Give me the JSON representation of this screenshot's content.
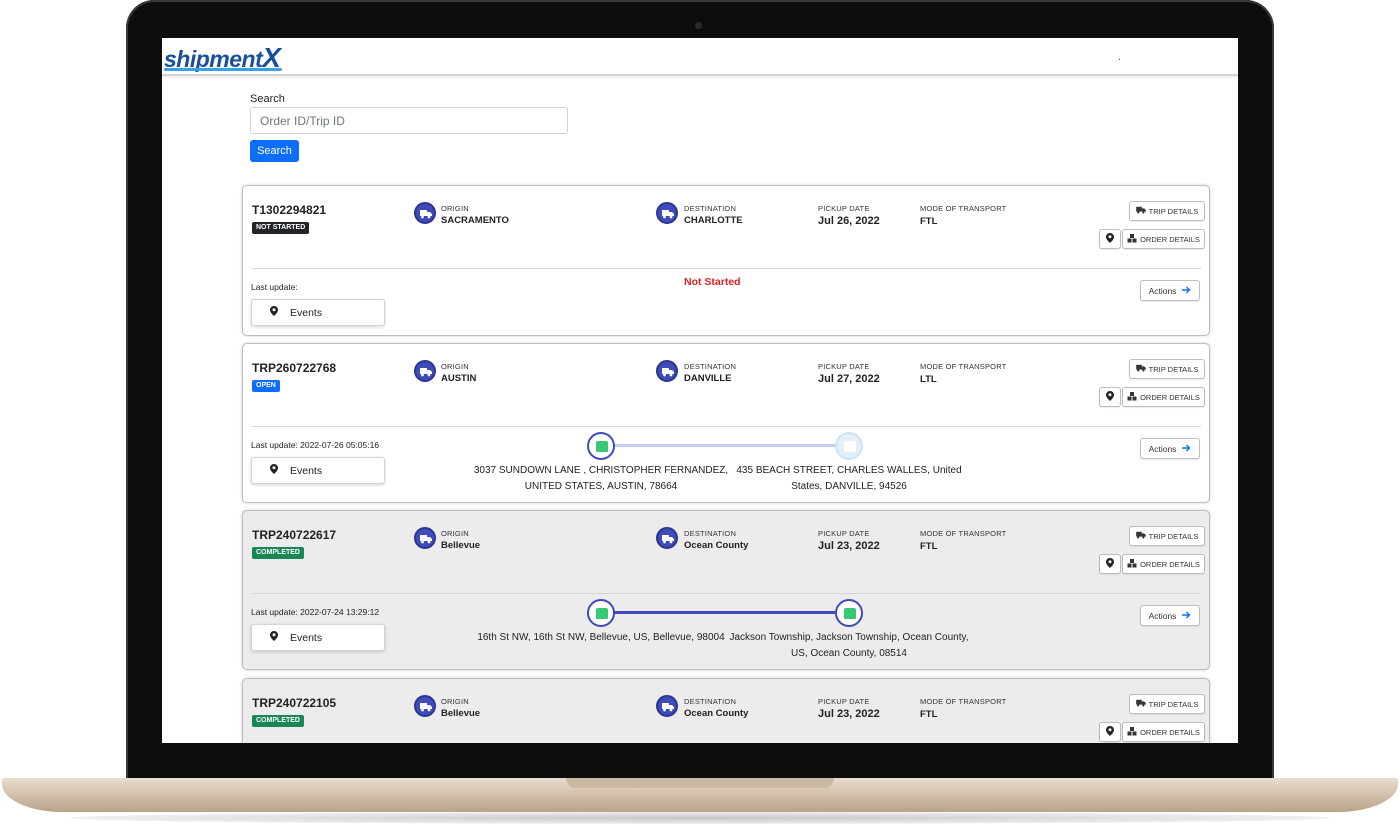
{
  "app": {
    "logo_text": "shipment",
    "logo_x": "X",
    "header_dot": "."
  },
  "search": {
    "label": "Search",
    "placeholder": "Order ID/Trip ID",
    "button": "Search"
  },
  "labels": {
    "origin": "ORIGIN",
    "destination": "DESTINATION",
    "pickup_date": "PICKUP DATE",
    "mode": "MODE OF TRANSPORT",
    "trip_details": "TRIP DETAILS",
    "order_details": "ORDER DETAILS",
    "actions": "Actions",
    "events": "Events"
  },
  "trips": [
    {
      "id": "T1302294821",
      "status": "NOT STARTED",
      "status_color": "#212529",
      "origin": "SACRAMENTO",
      "destination": "CHARLOTTE",
      "pickup_date": "Jul 26, 2022",
      "mode": "FTL",
      "last_update": "Last update:",
      "status_message": "Not Started"
    },
    {
      "id": "TRP260722768",
      "status": "OPEN",
      "status_color": "#0d6efd",
      "origin": "AUSTIN",
      "destination": "DANVILLE",
      "pickup_date": "Jul 27, 2022",
      "mode": "LTL",
      "last_update": "Last update: 2022-07-26 05:05:16",
      "origin_address": "3037 SUNDOWN LANE , CHRISTOPHER FERNANDEZ, UNITED STATES, AUSTIN, 78664",
      "destination_address": "435 BEACH STREET, CHARLES WALLES, United States, DANVILLE, 94526",
      "progress": 0.0
    },
    {
      "id": "TRP240722617",
      "status": "COMPLETED",
      "status_color": "#198754",
      "origin": "Bellevue",
      "destination": "Ocean County",
      "pickup_date": "Jul 23, 2022",
      "mode": "FTL",
      "last_update": "Last update: 2022-07-24 13:29:12",
      "origin_address": "16th St NW, 16th St NW, Bellevue, US, Bellevue, 98004",
      "destination_address": "Jackson Township, Jackson Township, Ocean County, US, Ocean County, 08514",
      "progress": 1.0
    },
    {
      "id": "TRP240722105",
      "status": "COMPLETED",
      "status_color": "#198754",
      "origin": "Bellevue",
      "destination": "Ocean County",
      "pickup_date": "Jul 23, 2022",
      "mode": "FTL"
    }
  ],
  "colors": {
    "primary": "#0d6efd",
    "route": "#3f4bb8",
    "route_pending": "#c3cdf0",
    "alert": "#dc1f1f"
  }
}
